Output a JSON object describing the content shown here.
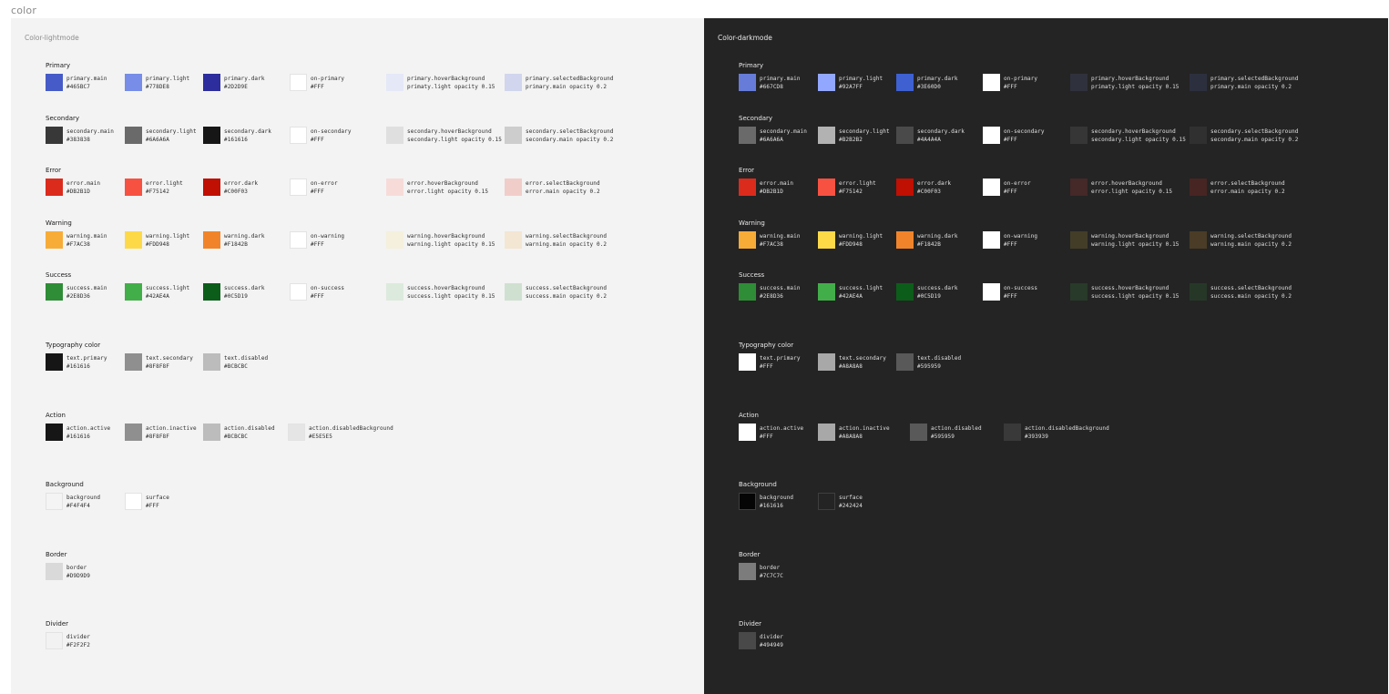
{
  "page_title": "color",
  "frames": [
    {
      "theme": "light",
      "title": "Color-lightmode",
      "sections": [
        {
          "title": "Primary",
          "swatches": [
            {
              "name": "primary.main",
              "value": "#465BC7",
              "color": "#465BC7"
            },
            {
              "name": "primary.light",
              "value": "#778DE8",
              "color": "#778DE8"
            },
            {
              "name": "primary.dark",
              "value": "#2D2D9E",
              "color": "#2D2D9E"
            },
            {
              "name": "on-primary",
              "value": "#FFF",
              "color": "#FFFFFF"
            },
            {
              "name": "primary.hoverBackground",
              "value": "primaty.light opacity 0.15",
              "color": "#E4E8F7"
            },
            {
              "name": "primary.selectedBackground",
              "value": "primary.main opacity 0.2",
              "color": "#D1D5EE"
            }
          ]
        },
        {
          "title": "Secondary",
          "swatches": [
            {
              "name": "secondary.main",
              "value": "#383838",
              "color": "#383838"
            },
            {
              "name": "secondary.light",
              "value": "#6A6A6A",
              "color": "#6A6A6A"
            },
            {
              "name": "secondary.dark",
              "value": "#161616",
              "color": "#161616"
            },
            {
              "name": "on-secondary",
              "value": "#FFF",
              "color": "#FFFFFF"
            },
            {
              "name": "secondary.hoverBackground",
              "value": "secondary.light opacity 0.15",
              "color": "#DFDFDF"
            },
            {
              "name": "secondary.selectBackground",
              "value": "secondary.main opacity 0.2",
              "color": "#CDCDCD"
            }
          ]
        },
        {
          "title": "Error",
          "swatches": [
            {
              "name": "error.main",
              "value": "#DB2B1D",
              "color": "#DB2B1D"
            },
            {
              "name": "error.light",
              "value": "#F75142",
              "color": "#F75142"
            },
            {
              "name": "error.dark",
              "value": "#C00F03",
              "color": "#C00F03"
            },
            {
              "name": "on-error",
              "value": "#FFF",
              "color": "#FFFFFF"
            },
            {
              "name": "error.hoverBackground",
              "value": "error.light opacity 0.15",
              "color": "#F6DBD9"
            },
            {
              "name": "error.selectBackground",
              "value": "error.main opacity 0.2",
              "color": "#F1CDCA"
            }
          ]
        },
        {
          "title": "Warning",
          "swatches": [
            {
              "name": "warning.main",
              "value": "#F7AC38",
              "color": "#F7AC38"
            },
            {
              "name": "warning.light",
              "value": "#FDD948",
              "color": "#FDD948"
            },
            {
              "name": "warning.dark",
              "value": "#F1842B",
              "color": "#F1842B"
            },
            {
              "name": "on-warning",
              "value": "#FFF",
              "color": "#FFFFFF"
            },
            {
              "name": "warning.hoverBackground",
              "value": "warning.light opacity 0.15",
              "color": "#F4F0DD"
            },
            {
              "name": "warning.selectBackground",
              "value": "warning.main opacity 0.2",
              "color": "#F3E6D2"
            }
          ]
        },
        {
          "title": "Success",
          "swatches": [
            {
              "name": "success.main",
              "value": "#2E8D36",
              "color": "#2E8D36"
            },
            {
              "name": "success.light",
              "value": "#42AE4A",
              "color": "#42AE4A"
            },
            {
              "name": "success.dark",
              "value": "#0C5D19",
              "color": "#0C5D19"
            },
            {
              "name": "on-success",
              "value": "#FFF",
              "color": "#FFFFFF"
            },
            {
              "name": "success.hoverBackground",
              "value": "success.light opacity 0.15",
              "color": "#DBEADC"
            },
            {
              "name": "success.selectBackground",
              "value": "success.main opacity 0.2",
              "color": "#CFE0D0"
            }
          ]
        },
        {
          "title": "Typography color",
          "swatches": [
            {
              "name": "text.primary",
              "value": "#161616",
              "color": "#161616"
            },
            {
              "name": "text.secondary",
              "value": "#8F8F8F",
              "color": "#8F8F8F"
            },
            {
              "name": "text.disabled",
              "value": "#BCBCBC",
              "color": "#BCBCBC"
            }
          ]
        },
        {
          "title": "Action",
          "swatches": [
            {
              "name": "action.active",
              "value": "#161616",
              "color": "#161616"
            },
            {
              "name": "action.inactive",
              "value": "#8F8F8F",
              "color": "#8F8F8F"
            },
            {
              "name": "action.disabled",
              "value": "#BCBCBC",
              "color": "#BCBCBC"
            },
            {
              "name": "action.disabledBackground",
              "value": "#E5E5E5",
              "color": "#E5E5E5"
            }
          ]
        },
        {
          "title": "Background",
          "swatches": [
            {
              "name": "background",
              "value": "#F4F4F4",
              "color": "#F4F4F4"
            },
            {
              "name": "surface",
              "value": "#FFF",
              "color": "#FFFFFF"
            }
          ]
        },
        {
          "title": "Border",
          "swatches": [
            {
              "name": "border",
              "value": "#D9D9D9",
              "color": "#D9D9D9"
            }
          ]
        },
        {
          "title": "Divider",
          "swatches": [
            {
              "name": "divider",
              "value": "#F2F2F2",
              "color": "#F2F2F2"
            }
          ]
        }
      ]
    },
    {
      "theme": "dark",
      "title": "Color-darkmode",
      "sections": [
        {
          "title": "Primary",
          "swatches": [
            {
              "name": "primary.main",
              "value": "#667CD8",
              "color": "#667CD8"
            },
            {
              "name": "primary.light",
              "value": "#92A7FF",
              "color": "#92A7FF"
            },
            {
              "name": "primary.dark",
              "value": "#3E60D0",
              "color": "#3E60D0"
            },
            {
              "name": "on-primary",
              "value": "#FFF",
              "color": "#FFFFFF"
            },
            {
              "name": "primary.hoverBackground",
              "value": "primaty.light opacity 0.15",
              "color": "#2F323C"
            },
            {
              "name": "primary.selectedBackground",
              "value": "primary.main opacity 0.2",
              "color": "#2C2F3E"
            }
          ]
        },
        {
          "title": "Secondary",
          "swatches": [
            {
              "name": "secondary.main",
              "value": "#6A6A6A",
              "color": "#6A6A6A"
            },
            {
              "name": "secondary.light",
              "value": "#B2B2B2",
              "color": "#B2B2B2"
            },
            {
              "name": "secondary.dark",
              "value": "#4A4A4A",
              "color": "#4A4A4A"
            },
            {
              "name": "on-secondary",
              "value": "#FFF",
              "color": "#FFFFFF"
            },
            {
              "name": "secondary.hoverBackground",
              "value": "secondary.light opacity 0.15",
              "color": "#363636"
            },
            {
              "name": "secondary.selectBackground",
              "value": "secondary.main opacity 0.2",
              "color": "#303030"
            }
          ]
        },
        {
          "title": "Error",
          "swatches": [
            {
              "name": "error.main",
              "value": "#DB2B1D",
              "color": "#DB2B1D"
            },
            {
              "name": "error.light",
              "value": "#F75142",
              "color": "#F75142"
            },
            {
              "name": "error.dark",
              "value": "#C00F03",
              "color": "#C00F03"
            },
            {
              "name": "on-error",
              "value": "#FFF",
              "color": "#FFFFFF"
            },
            {
              "name": "error.hoverBackground",
              "value": "error.light opacity 0.15",
              "color": "#452828"
            },
            {
              "name": "error.selectBackground",
              "value": "error.main opacity 0.2",
              "color": "#472523"
            }
          ]
        },
        {
          "title": "Warning",
          "swatches": [
            {
              "name": "warning.main",
              "value": "#F7AC38",
              "color": "#F7AC38"
            },
            {
              "name": "warning.light",
              "value": "#FDD948",
              "color": "#FDD948"
            },
            {
              "name": "warning.dark",
              "value": "#F1842B",
              "color": "#F1842B"
            },
            {
              "name": "on-warning",
              "value": "#FFF",
              "color": "#FFFFFF"
            },
            {
              "name": "warning.hoverBackground",
              "value": "warning.light opacity 0.15",
              "color": "#433D28"
            },
            {
              "name": "warning.selectBackground",
              "value": "warning.main opacity 0.2",
              "color": "#4A3C26"
            }
          ]
        },
        {
          "title": "Success",
          "swatches": [
            {
              "name": "success.main",
              "value": "#2E8D36",
              "color": "#2E8D36"
            },
            {
              "name": "success.light",
              "value": "#42AE4A",
              "color": "#42AE4A"
            },
            {
              "name": "success.dark",
              "value": "#0C5D19",
              "color": "#0C5D19"
            },
            {
              "name": "on-success",
              "value": "#FFF",
              "color": "#FFFFFF"
            },
            {
              "name": "success.hoverBackground",
              "value": "success.light opacity 0.15",
              "color": "#283A29"
            },
            {
              "name": "success.selectBackground",
              "value": "success.main opacity 0.2",
              "color": "#263727"
            }
          ]
        },
        {
          "title": "Typography color",
          "swatches": [
            {
              "name": "text.primary",
              "value": "#FFF",
              "color": "#FFFFFF"
            },
            {
              "name": "text.secondary",
              "value": "#A8A8A8",
              "color": "#A8A8A8"
            },
            {
              "name": "text.disabled",
              "value": "#595959",
              "color": "#595959"
            }
          ]
        },
        {
          "title": "Action",
          "swatches": [
            {
              "name": "action.active",
              "value": "#FFF",
              "color": "#FFFFFF"
            },
            {
              "name": "action.inactive",
              "value": "#A8A8A8",
              "color": "#A8A8A8"
            },
            {
              "name": "action.disabled",
              "value": "#595959",
              "color": "#595959"
            },
            {
              "name": "action.disabledBackground",
              "value": "#393939",
              "color": "#393939"
            }
          ]
        },
        {
          "title": "Background",
          "swatches": [
            {
              "name": "background",
              "value": "#161616",
              "color": "#050505"
            },
            {
              "name": "surface",
              "value": "#242424",
              "color": "#242424"
            }
          ]
        },
        {
          "title": "Border",
          "swatches": [
            {
              "name": "border",
              "value": "#7C7C7C",
              "color": "#7C7C7C"
            }
          ]
        },
        {
          "title": "Divider",
          "swatches": [
            {
              "name": "divider",
              "value": "#494949",
              "color": "#494949"
            }
          ]
        }
      ]
    }
  ]
}
